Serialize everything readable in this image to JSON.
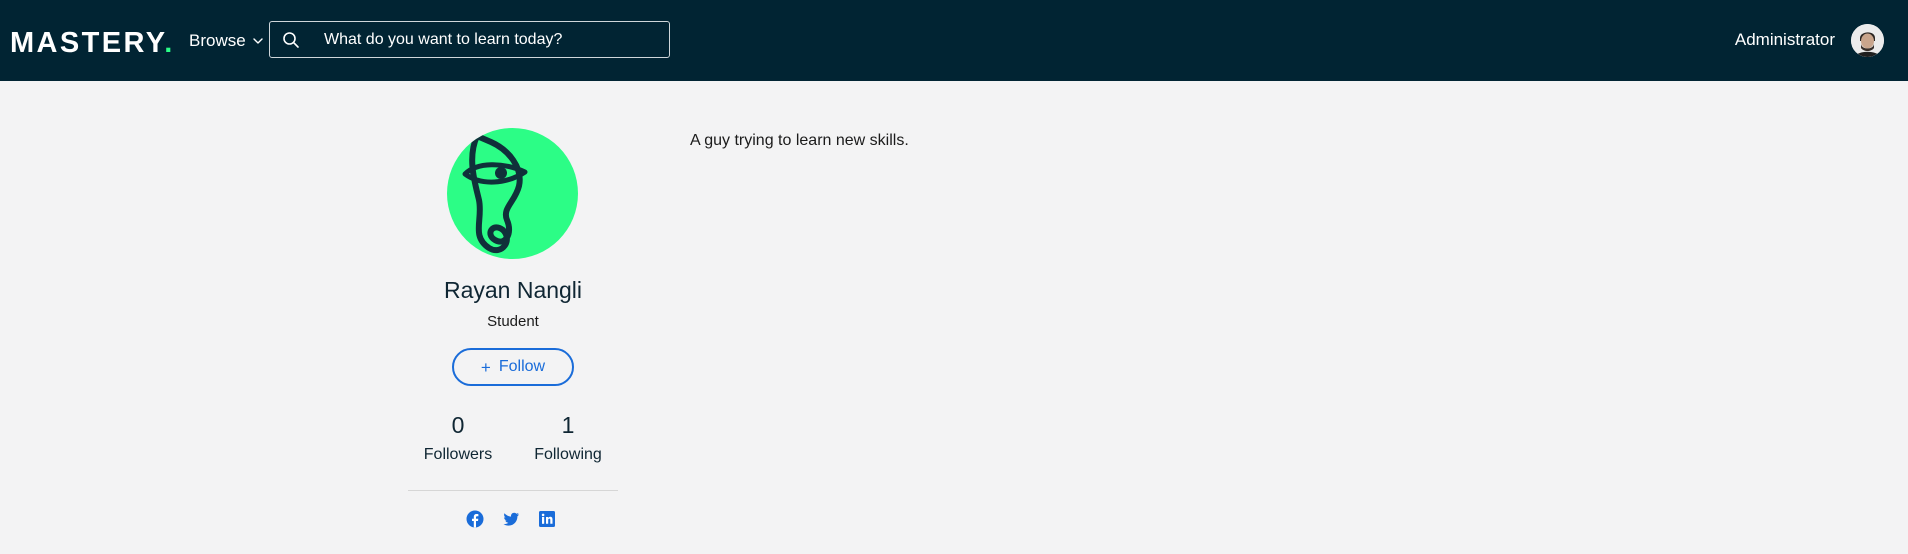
{
  "header": {
    "logo_text": "MASTERY",
    "logo_dot": ".",
    "browse_label": "Browse",
    "search_placeholder": "What do you want to learn today?",
    "user_name": "Administrator"
  },
  "profile": {
    "name": "Rayan Nangli",
    "role": "Student",
    "follow_label": "Follow",
    "followers_count": "0",
    "followers_label": "Followers",
    "following_count": "1",
    "following_label": "Following",
    "bio": "A guy trying to learn new skills."
  },
  "socials": [
    "facebook-icon",
    "twitter-icon",
    "linkedin-icon"
  ],
  "colors": {
    "nav_bg": "#012433",
    "accent": "#2bff88",
    "link_blue": "#1a6cd9",
    "page_bg": "#f3f3f4"
  }
}
